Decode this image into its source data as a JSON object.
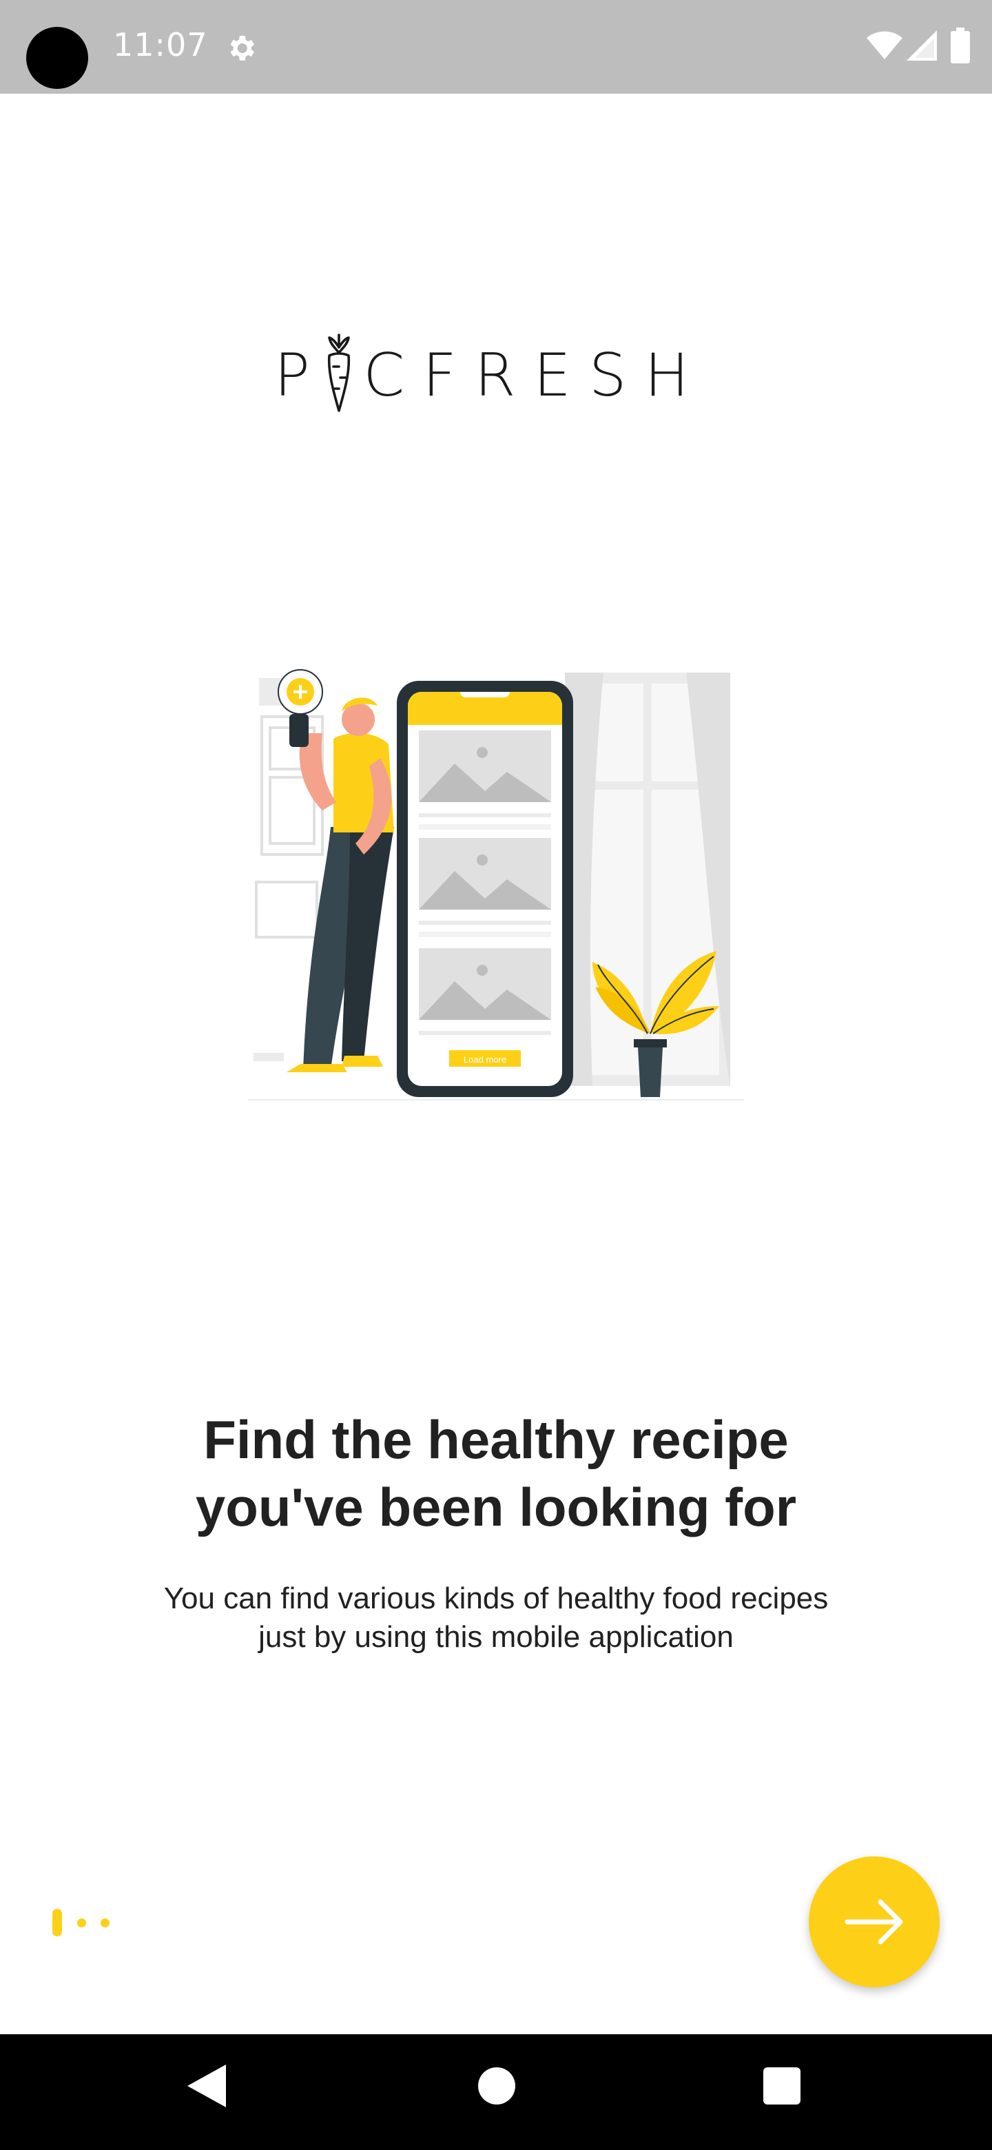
{
  "status_bar": {
    "time": "11:07",
    "icons": [
      "camera-cutout",
      "gear-icon",
      "wifi-icon",
      "signal-icon",
      "battery-icon"
    ]
  },
  "logo": {
    "text": "PICFRESH",
    "carrot_replaces_letter": "I"
  },
  "illustration": {
    "phone_button_label": "Load more"
  },
  "onboarding": {
    "title_line1": "Find the healthy recipe",
    "title_line2": "you've been looking for",
    "subtitle_line1": "You can find various kinds of healthy food recipes",
    "subtitle_line2": "just by using this mobile application"
  },
  "pager": {
    "total_pages": 3,
    "current_page": 1
  },
  "next_button": {
    "icon": "arrow-right-icon"
  },
  "nav_bar": {
    "icons": [
      "back-icon",
      "home-icon",
      "recents-icon"
    ]
  },
  "colors": {
    "accent": "#fdd017",
    "text": "#212121",
    "status_bar": "#bdbdbd",
    "nav_bar": "#000000",
    "dark_ink": "#263238"
  }
}
